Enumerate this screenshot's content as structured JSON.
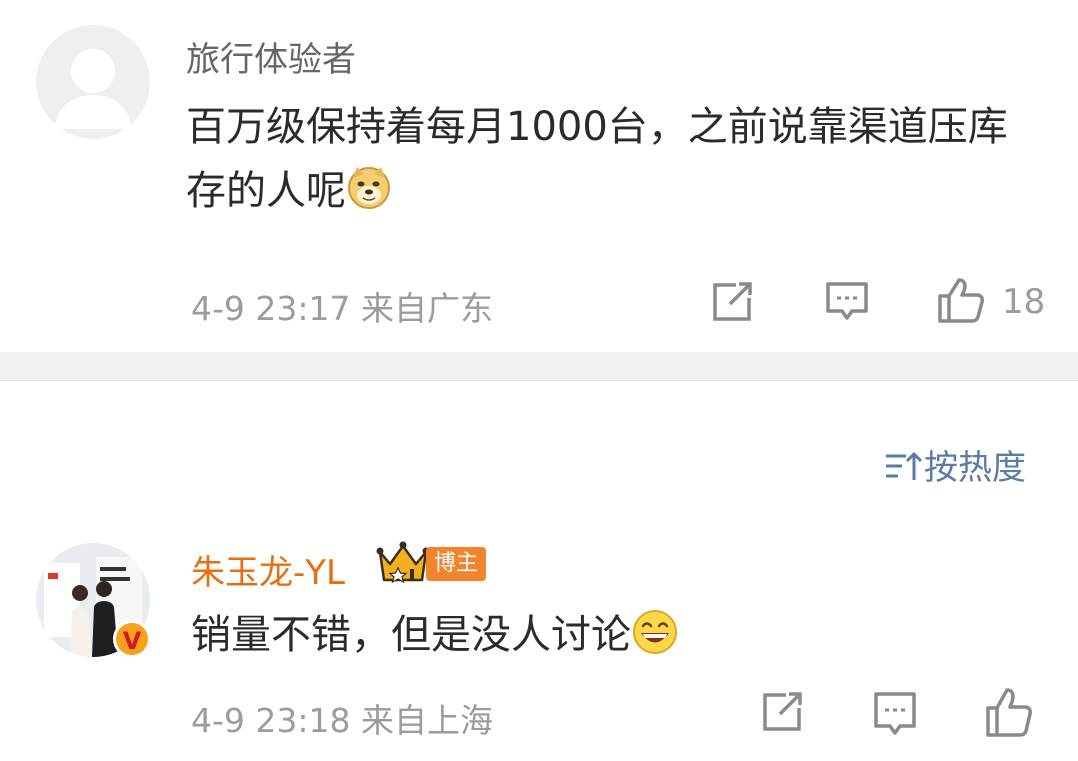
{
  "comments": [
    {
      "username": "旅行体验者",
      "text": "百万级保持着每月1000台，之前说靠渠道压库存的人呢",
      "emoji": "doge-emoji",
      "timestamp": "4-9 23:17",
      "location": "来自广东",
      "like_count": "18"
    },
    {
      "username": "朱玉龙-YL",
      "badge_label": "博主",
      "text": "销量不错，但是没人讨论",
      "emoji": "grin-emoji",
      "timestamp": "4-9 23:18",
      "location": "来自上海"
    }
  ],
  "sort": {
    "label": "按热度",
    "icon": "sort-icon"
  },
  "colors": {
    "username_vip": "#e76f12",
    "sort_link": "#5a7da6",
    "meta_gray": "#9c9c9c",
    "badge_orange": "#f2842d"
  }
}
